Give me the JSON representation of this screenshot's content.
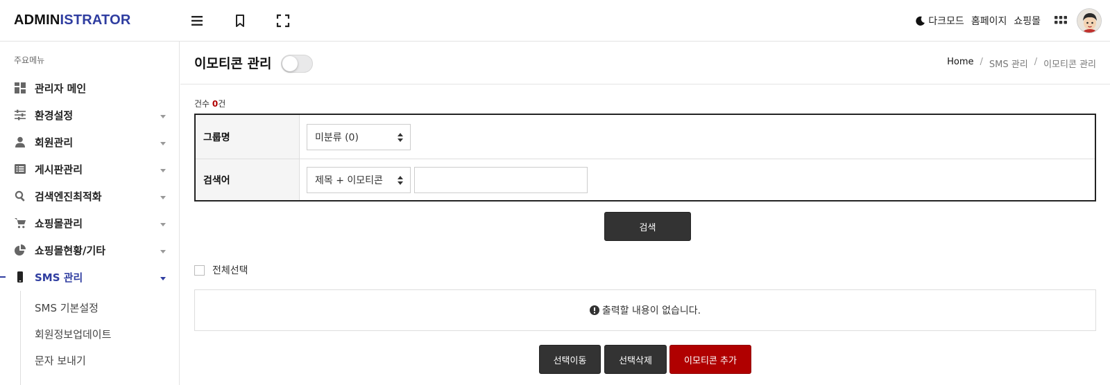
{
  "header": {
    "logo_part1": "ADMIN",
    "logo_part2": "ISTRATOR",
    "tools": [
      "menu-icon",
      "bookmark-icon",
      "fullscreen-icon"
    ],
    "links": {
      "darkmode": "다크모드",
      "homepage": "홈페이지",
      "shop": "쇼핑몰"
    }
  },
  "sidebar": {
    "caption": "주요메뉴",
    "items": [
      {
        "label": "관리자 메인",
        "icon": "dashboard-icon",
        "caret": false
      },
      {
        "label": "환경설정",
        "icon": "sliders-icon",
        "caret": true
      },
      {
        "label": "회원관리",
        "icon": "user-icon",
        "caret": true
      },
      {
        "label": "게시판관리",
        "icon": "list-icon",
        "caret": true
      },
      {
        "label": "검색엔진최적화",
        "icon": "search-icon",
        "caret": true
      },
      {
        "label": "쇼핑몰관리",
        "icon": "cart-icon",
        "caret": true
      },
      {
        "label": "쇼핑몰현황/기타",
        "icon": "pie-chart-icon",
        "caret": true
      },
      {
        "label": "SMS 관리",
        "icon": "mobile-icon",
        "caret": true,
        "active": true
      }
    ],
    "subitems": [
      "SMS 기본설정",
      "회원정보업데이트",
      "문자 보내기"
    ]
  },
  "page": {
    "title": "이모티콘 관리",
    "breadcrumb": [
      "Home",
      "SMS 관리",
      "이모티콘 관리"
    ],
    "count": {
      "prefix": "건수 ",
      "value": "0",
      "suffix": "건"
    }
  },
  "search": {
    "group_label": "그룹명",
    "group_selected": "미분류 (0)",
    "keyword_label": "검색어",
    "keyword_field_selected": "제목 + 이모티콘",
    "keyword_value": "",
    "submit_label": "검색"
  },
  "list": {
    "select_all_label": "전체선택",
    "empty_message": "출력할 내용이 없습니다."
  },
  "actions": {
    "move_label": "선택이동",
    "delete_label": "선택삭제",
    "add_label": "이모티콘 추가"
  },
  "colors": {
    "accent": "#2f3da0",
    "danger": "#b00000",
    "dark_button": "#333333"
  }
}
